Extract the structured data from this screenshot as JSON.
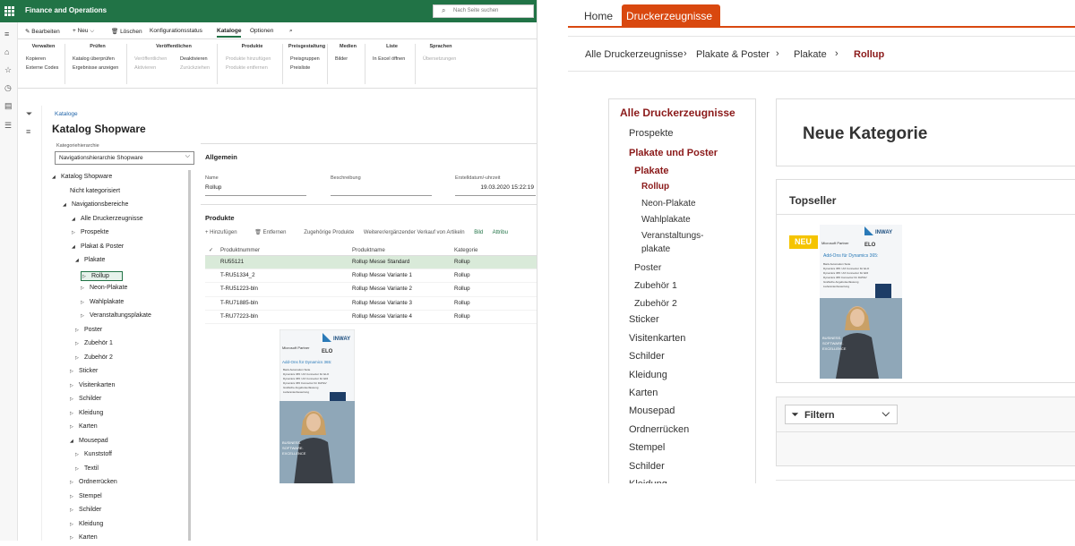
{
  "left": {
    "app_name": "Finance and Operations",
    "search_placeholder": "Nach Seite suchen",
    "toolbar": [
      "Bearbeiten",
      "Neu",
      "Löschen",
      "Konfigurationsstatus",
      "Kataloge",
      "Optionen"
    ],
    "ribbon": [
      {
        "title": "Verwalten",
        "items": [
          "Kopieren",
          "Externe Codes"
        ]
      },
      {
        "title": "Prüfen",
        "items": [
          "Katalog überprüfen",
          "Ergebnisse anzeigen"
        ]
      },
      {
        "title": "Veröffentlichen",
        "items": [
          "Veröffentlichen",
          "Aktivieren",
          "Deaktivieren",
          "Zurückziehen"
        ]
      },
      {
        "title": "Produkte",
        "items": [
          "Produkte hinzufügen",
          "Produkte entfernen"
        ]
      },
      {
        "title": "Preisgestaltung",
        "items": [
          "Preisgruppen",
          "Preisliste"
        ]
      },
      {
        "title": "Medien",
        "items": [
          "Bilder"
        ]
      },
      {
        "title": "Liste",
        "items": [
          "In Excel öffnen"
        ]
      },
      {
        "title": "Sprachen",
        "items": [
          "Übersetzungen"
        ]
      }
    ],
    "breadcrumb": "Kataloge",
    "page_title": "Katalog Shopware",
    "hierarchy_label": "Kategoriehierarchie",
    "hierarchy_value": "Navigationshierarchie Shopware",
    "tree": [
      {
        "label": "Katalog Shopware",
        "twisty": "◢"
      },
      {
        "label": "Nicht kategorisiert",
        "twisty": ""
      },
      {
        "label": "Navigationsbereiche",
        "twisty": "◢"
      },
      {
        "label": "Alle Druckerzeugnisse",
        "twisty": "◢"
      },
      {
        "label": "Prospekte",
        "twisty": "▷"
      },
      {
        "label": "Plakat & Poster",
        "twisty": "◢"
      },
      {
        "label": "Plakate",
        "twisty": "◢"
      },
      {
        "label": "Rollup",
        "twisty": "▷"
      },
      {
        "label": "Neon-Plakate",
        "twisty": "▷"
      },
      {
        "label": "Wahlplakate",
        "twisty": "▷"
      },
      {
        "label": "Veranstaltungsplakate",
        "twisty": "▷"
      },
      {
        "label": "Poster",
        "twisty": "▷"
      },
      {
        "label": "Zubehör 1",
        "twisty": "▷"
      },
      {
        "label": "Zubehör 2",
        "twisty": "▷"
      },
      {
        "label": "Sticker",
        "twisty": "▷"
      },
      {
        "label": "Visitenkarten",
        "twisty": "▷"
      },
      {
        "label": "Schilder",
        "twisty": "▷"
      },
      {
        "label": "Kleidung",
        "twisty": "▷"
      },
      {
        "label": "Karten",
        "twisty": "▷"
      },
      {
        "label": "Mousepad",
        "twisty": "◢"
      },
      {
        "label": "Kunststoff",
        "twisty": "▷"
      },
      {
        "label": "Textil",
        "twisty": "▷"
      },
      {
        "label": "Ordnerrücken",
        "twisty": "▷"
      },
      {
        "label": "Stempel",
        "twisty": "▷"
      },
      {
        "label": "Schilder",
        "twisty": "▷"
      },
      {
        "label": "Kleidung",
        "twisty": "▷"
      },
      {
        "label": "Karten",
        "twisty": "▷"
      }
    ],
    "general": {
      "title": "Allgemein",
      "name_label": "Name",
      "name_value": "Rollup",
      "desc_label": "Beschreibung",
      "desc_value": "",
      "date_label": "Erstelldatum/-uhrzeit",
      "date_value": "19.03.2020 15:22:19"
    },
    "products": {
      "title": "Produkte",
      "toolbar": [
        "Hinzufügen",
        "Entfernen",
        "Zugehörige Produkte",
        "Weiterer/ergänzender Verkauf von Artikeln",
        "Bild",
        "Attribu"
      ],
      "columns": [
        "Produktnummer",
        "Produktname",
        "Kategorie"
      ],
      "rows": [
        {
          "nr": "RU55121",
          "name": "Rollup Messe Standard",
          "cat": "Rollup"
        },
        {
          "nr": "T-RU51334_2",
          "name": "Rollup Messe Variante 1",
          "cat": "Rollup"
        },
        {
          "nr": "T-RU51223-bln",
          "name": "Rollup Messe Variante 2",
          "cat": "Rollup"
        },
        {
          "nr": "T-RU71885-bln",
          "name": "Rollup Messe Variante 3",
          "cat": "Rollup"
        },
        {
          "nr": "T-RU77223-bln",
          "name": "Rollup Messe Variante 4",
          "cat": "Rollup"
        }
      ]
    },
    "flyer": {
      "brand": "INWAY",
      "partner": "Microsoft Partner",
      "elo": "ELO",
      "headline": "Add-Ons für Dynamics 365:",
      "bullets": [
        "Bank Automation Suite",
        "Dynamics 365 / AX Connector für ELO",
        "Dynamics 365 / AX Connector für EDI",
        "Dynamics 365 Connector für DATEV",
        "Grafische Angebotserfassung",
        "Lieferantenbewertung"
      ],
      "slogan": [
        "BUSINESS.",
        "SOFTWARE.",
        "EXCELLENCE"
      ]
    }
  },
  "right": {
    "tabs": [
      "Home",
      "Druckerzeugnisse"
    ],
    "breadcrumb": [
      "Alle Druckerzeugnisse",
      "Plakate & Poster",
      "Plakate",
      "Rollup"
    ],
    "categories": [
      {
        "label": "Alle Druckerzeugnisse",
        "level": 0,
        "style": "head"
      },
      {
        "label": "Prospekte",
        "level": 1,
        "style": "normal"
      },
      {
        "label": "Plakate und Poster",
        "level": 1,
        "style": "active"
      },
      {
        "label": "Plakate",
        "level": 2,
        "style": "active"
      },
      {
        "label": "Rollup",
        "level": 3,
        "style": "active"
      },
      {
        "label": "Neon-Plakate",
        "level": 3,
        "style": "normal"
      },
      {
        "label": "Wahlplakate",
        "level": 3,
        "style": "normal"
      },
      {
        "label": "Veranstaltungs-",
        "level": 3,
        "style": "normal"
      },
      {
        "label": "plakate",
        "level": 3,
        "style": "normal"
      },
      {
        "label": "Poster",
        "level": 2,
        "style": "normal"
      },
      {
        "label": "Zubehör 1",
        "level": 2,
        "style": "normal"
      },
      {
        "label": "Zubehör 2",
        "level": 2,
        "style": "normal"
      },
      {
        "label": "Sticker",
        "level": 1,
        "style": "normal"
      },
      {
        "label": "Visitenkarten",
        "level": 1,
        "style": "normal"
      },
      {
        "label": "Schilder",
        "level": 1,
        "style": "normal"
      },
      {
        "label": "Kleidung",
        "level": 1,
        "style": "normal"
      },
      {
        "label": "Karten",
        "level": 1,
        "style": "normal"
      },
      {
        "label": "Mousepad",
        "level": 1,
        "style": "normal"
      },
      {
        "label": "Ordnerrücken",
        "level": 1,
        "style": "normal"
      },
      {
        "label": "Stempel",
        "level": 1,
        "style": "normal"
      },
      {
        "label": "Schilder",
        "level": 1,
        "style": "normal"
      },
      {
        "label": "Kleidung",
        "level": 1,
        "style": "normal"
      }
    ],
    "new_category": "Neue Kategorie",
    "topseller": "Topseller",
    "badge": "NEU",
    "filter": "Filtern"
  },
  "colors": {
    "d365_green": "#217346",
    "shop_red": "#d9480f",
    "shop_dark_red": "#8b1a1a"
  }
}
